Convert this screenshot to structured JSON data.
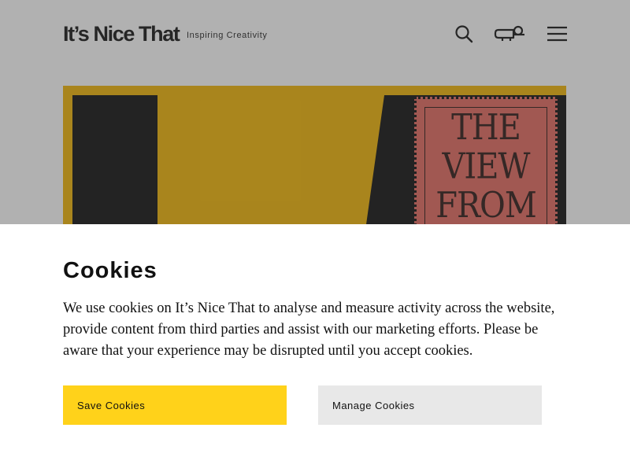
{
  "header": {
    "logo_text": "It’s Nice That",
    "tagline": "Inspiring Creativity",
    "icons": [
      "search-icon",
      "megaphone-icon",
      "menu-icon"
    ]
  },
  "hero": {
    "stamp_lines": "THE VIEW FROM",
    "colors": {
      "background": "#f2b400",
      "stamp": "#e3665c",
      "ink": "#0b0b0b"
    }
  },
  "cookie_banner": {
    "title": "Cookies",
    "body": "We use cookies on It’s Nice That to analyse and measure activity across the website, provide content from third parties and assist with our marketing efforts. Please be aware that your experience may be disrupted until you accept cookies.",
    "save_label": "Save Cookies",
    "manage_label": "Manage Cookies",
    "colors": {
      "save_button": "#ffd21a",
      "manage_button": "#e8e8e8"
    }
  }
}
